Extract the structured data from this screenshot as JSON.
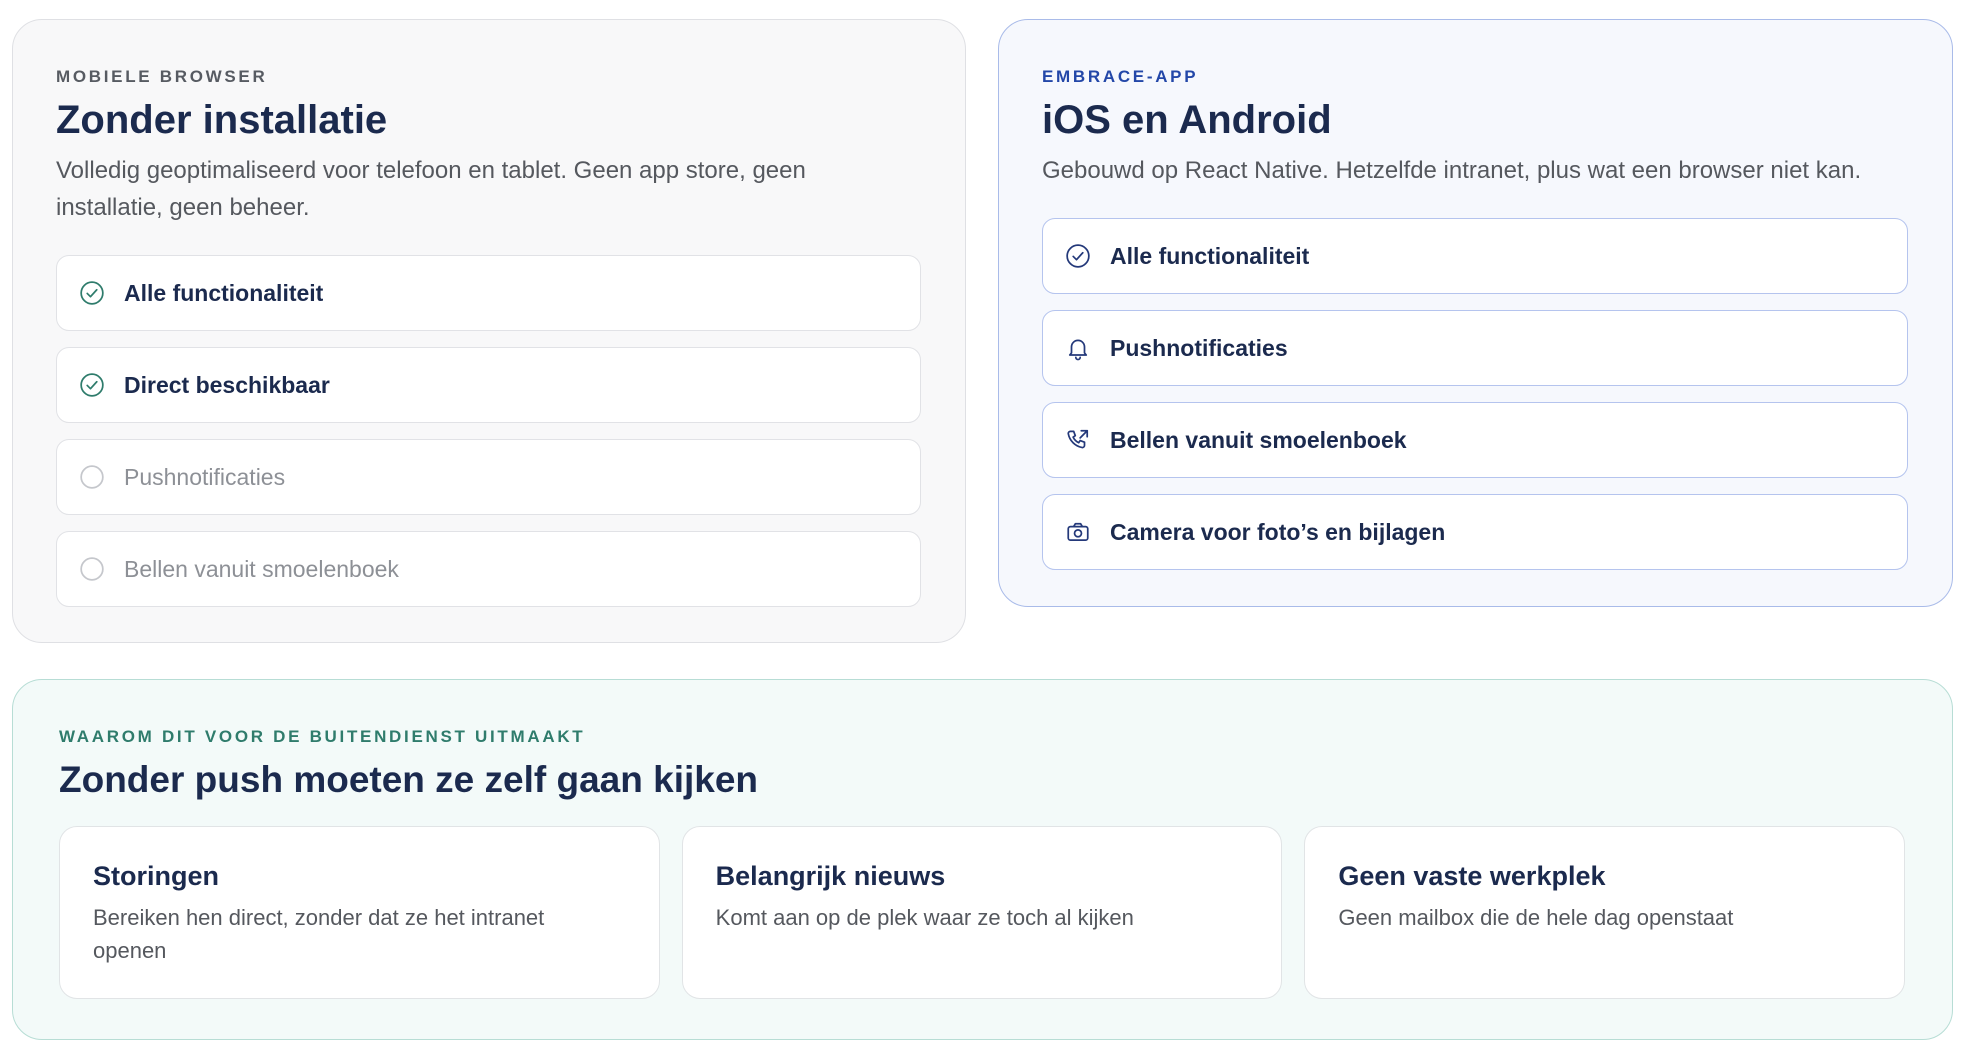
{
  "browser_card": {
    "eyebrow": "MOBIELE BROWSER",
    "title": "Zonder installatie",
    "description": "Volledig geoptimaliseerd voor telefoon en tablet. Geen app store, geen installatie, geen beheer.",
    "features": [
      {
        "label": "Alle functionaliteit",
        "icon": "check-circle-icon",
        "available": true
      },
      {
        "label": "Direct beschikbaar",
        "icon": "check-circle-icon",
        "available": true
      },
      {
        "label": "Pushnotificaties",
        "icon": "empty-circle-icon",
        "available": false
      },
      {
        "label": "Bellen vanuit smoelenboek",
        "icon": "empty-circle-icon",
        "available": false
      }
    ]
  },
  "app_card": {
    "eyebrow": "EMBRACE-APP",
    "title": "iOS en Android",
    "description": "Gebouwd op React Native. Hetzelfde intranet, plus wat een browser niet kan.",
    "features": [
      {
        "label": "Alle functionaliteit",
        "icon": "check-circle-icon"
      },
      {
        "label": "Pushnotificaties",
        "icon": "bell-icon"
      },
      {
        "label": "Bellen vanuit smoelenboek",
        "icon": "phone-outgoing-icon"
      },
      {
        "label": "Camera voor foto’s en bijlagen",
        "icon": "camera-icon"
      }
    ]
  },
  "why_section": {
    "eyebrow": "WAAROM DIT VOOR DE BUITENDIENST UITMAAKT",
    "title": "Zonder push moeten ze zelf gaan kijken",
    "cards": [
      {
        "title": "Storingen",
        "description": "Bereiken hen direct, zonder dat ze het intranet openen"
      },
      {
        "title": "Belangrijk nieuws",
        "description": "Komt aan op de plek waar ze toch al kijken"
      },
      {
        "title": "Geen vaste werkplek",
        "description": "Geen mailbox die de hele dag openstaat"
      }
    ]
  },
  "colors": {
    "heading": "#1b2a4e",
    "body_text": "#55585e",
    "browser_accent": "#2f7c6c",
    "app_accent": "#2347a8",
    "why_accent": "#2f7c6c",
    "unavailable": "#8d9096"
  }
}
